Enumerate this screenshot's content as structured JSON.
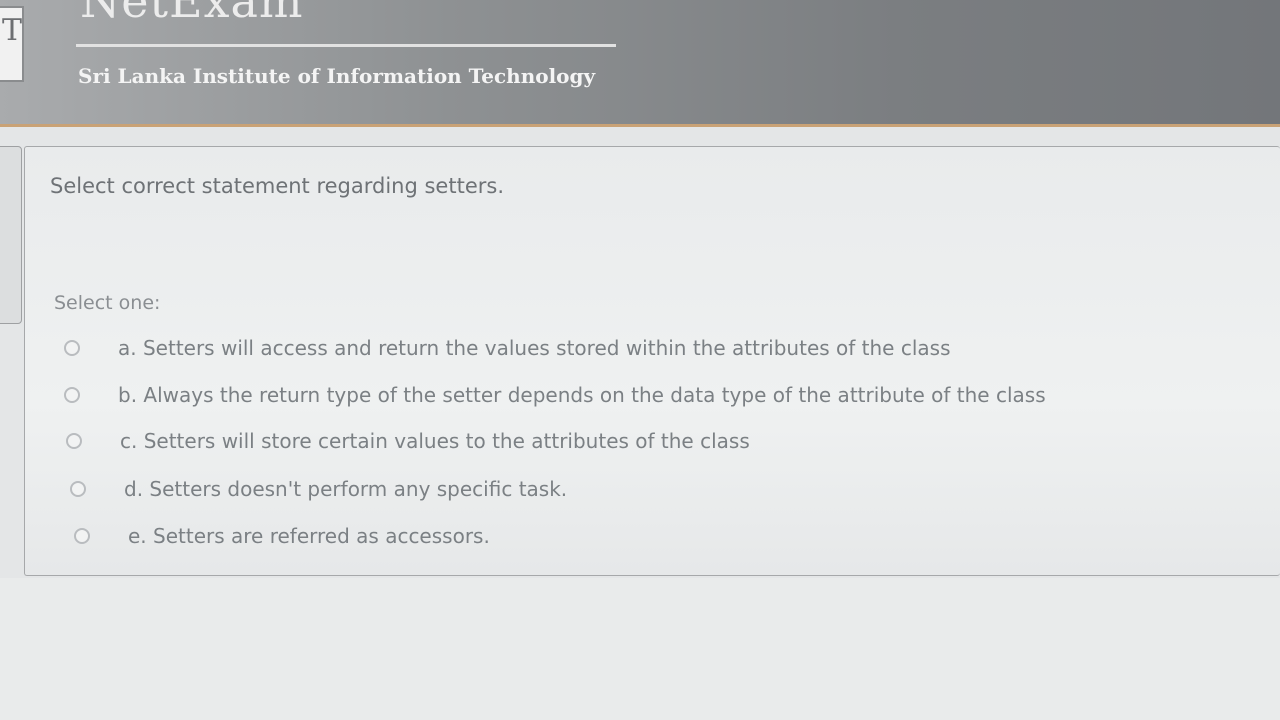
{
  "header": {
    "brand": "NetExam",
    "institution": "Sri Lanka Institute of Information Technology",
    "logo_letter": "T"
  },
  "question": {
    "text": "Select correct statement regarding setters.",
    "prompt": "Select one:",
    "options": [
      {
        "label": "a. Setters will access and return the values stored within the attributes of the class",
        "selected": false
      },
      {
        "label": "b. Always the return type of the setter depends on the data type of the attribute of the class",
        "selected": false
      },
      {
        "label": "c. Setters will store certain values to the attributes of the class",
        "selected": false
      },
      {
        "label": "d. Setters doesn't perform any specific task.",
        "selected": false
      },
      {
        "label": "e. Setters are referred as accessors.",
        "selected": false
      }
    ]
  }
}
